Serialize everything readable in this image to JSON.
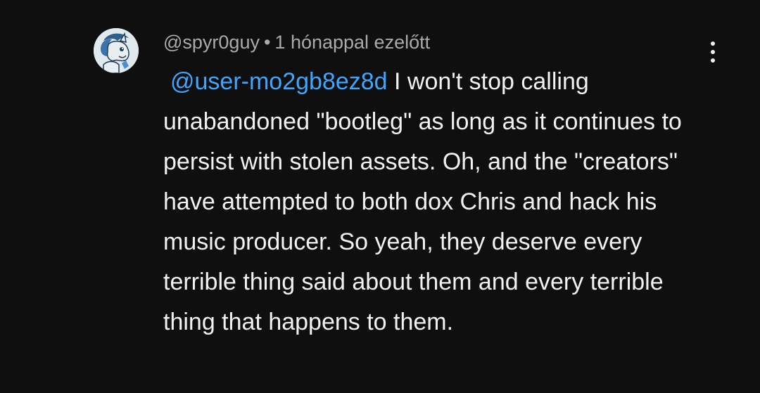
{
  "comment": {
    "author": "@spyr0guy",
    "separator": "•",
    "time": "1 hónappal ezelőtt",
    "mention": "@user-mo2gb8ez8d",
    "text": "I won't stop calling unabandoned \"bootleg\" as long as it continues to persist with stolen assets. Oh, and the \"creators\" have attempted to both dox Chris and hack his music producer. So yeah, they deserve every terrible thing said about them and every terrible thing that happens to them.",
    "avatar_icon": "pony-avatar",
    "menu_icon": "more-vertical-icon",
    "colors": {
      "background": "#0f0f0f",
      "text": "#f1f1f1",
      "meta": "#aaaaaa",
      "mention": "#3ea6ff"
    }
  }
}
